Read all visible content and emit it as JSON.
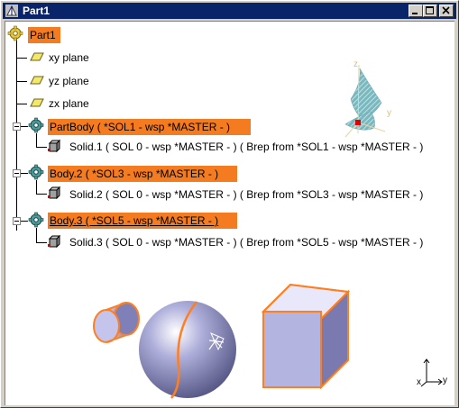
{
  "window": {
    "title": "Part1"
  },
  "tree": {
    "root": "Part1",
    "planes": [
      "xy plane",
      "yz plane",
      "zx plane"
    ],
    "bodies": [
      {
        "label": "PartBody ( *SOL1 - wsp *MASTER - )",
        "solid": "Solid.1 ( SOL 0 - wsp *MASTER - ) ( Brep from *SOL1 - wsp *MASTER - )"
      },
      {
        "label": "Body.2 ( *SOL3 - wsp *MASTER - )",
        "solid": "Solid.2 ( SOL 0 - wsp *MASTER - ) ( Brep from *SOL3 - wsp *MASTER - )"
      },
      {
        "label": "Body.3 ( *SOL5 - wsp *MASTER - )",
        "solid": "Solid.3 ( SOL 0 - wsp *MASTER - ) ( Brep from *SOL5 - wsp *MASTER - )"
      }
    ]
  },
  "compass": {
    "z": "z",
    "y": "y"
  },
  "axes": {
    "x": "x",
    "y": "y"
  },
  "colors": {
    "highlight": "#f47b20",
    "titlebar": "#0a246a",
    "solid": "#b3b3d9",
    "edge": "#ff7f20"
  }
}
